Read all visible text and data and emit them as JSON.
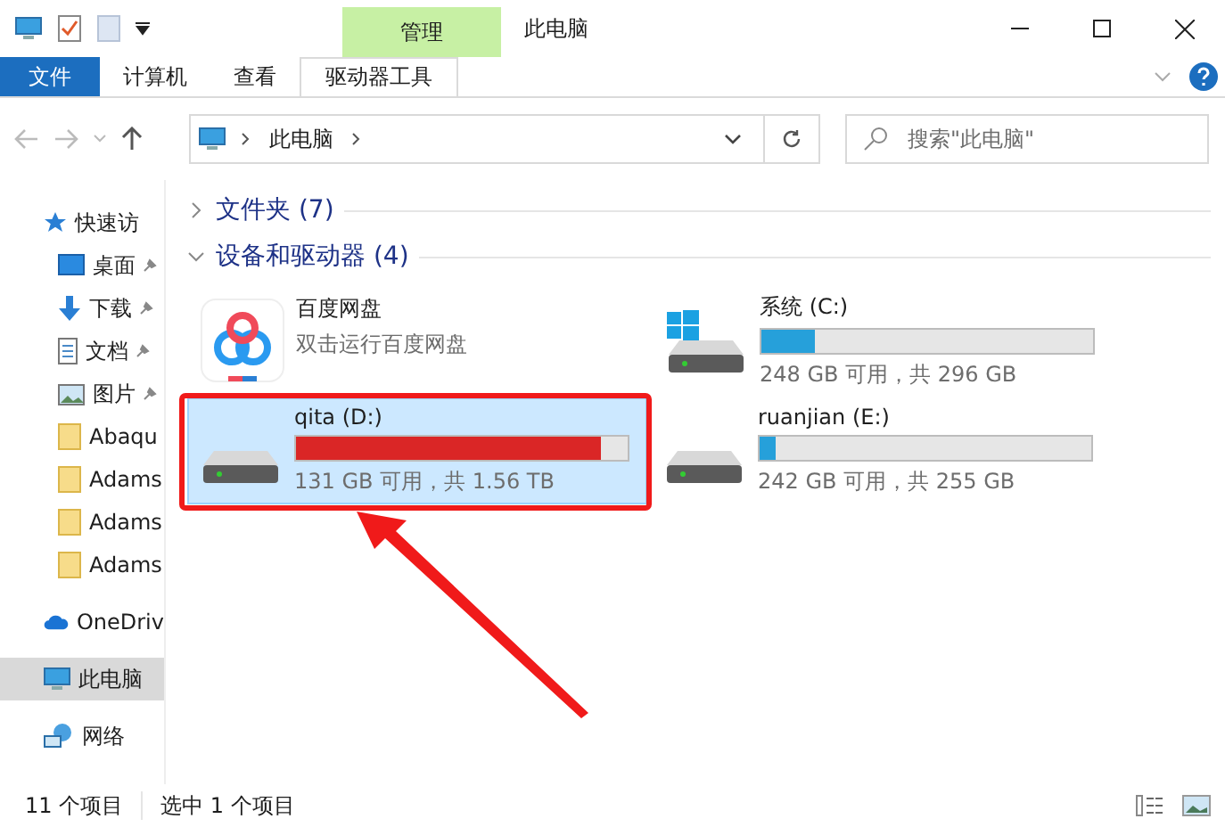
{
  "window": {
    "title": "此电脑",
    "context_tab": "管理"
  },
  "ribbon": {
    "tabs": [
      {
        "label": "文件",
        "kind": "file",
        "selected": false
      },
      {
        "label": "计算机",
        "kind": "tab",
        "selected": false
      },
      {
        "label": "查看",
        "kind": "tab",
        "selected": false
      },
      {
        "label": "驱动器工具",
        "kind": "tab",
        "selected": true
      }
    ]
  },
  "address": {
    "path": [
      "此电脑"
    ]
  },
  "search": {
    "placeholder": "搜索\"此电脑\""
  },
  "sidebar": {
    "items": [
      {
        "label": "快速访",
        "kind": "quick",
        "selected": false,
        "children": [
          {
            "label": "桌面",
            "kind": "desktop",
            "pinned": true,
            "selected": false
          },
          {
            "label": "下载",
            "kind": "download",
            "pinned": true,
            "selected": false
          },
          {
            "label": "文档",
            "kind": "document",
            "pinned": true,
            "selected": false
          },
          {
            "label": "图片",
            "kind": "pictures",
            "pinned": true,
            "selected": false
          },
          {
            "label": "Abaqu",
            "kind": "folder",
            "pinned": false,
            "selected": false
          },
          {
            "label": "Adams",
            "kind": "folder",
            "pinned": false,
            "selected": false
          },
          {
            "label": "Adams",
            "kind": "folder",
            "pinned": false,
            "selected": false
          },
          {
            "label": "Adams",
            "kind": "folder",
            "pinned": false,
            "selected": false
          }
        ]
      },
      {
        "label": "OneDriv",
        "kind": "cloud",
        "selected": false
      },
      {
        "label": "此电脑",
        "kind": "computer",
        "selected": true
      },
      {
        "label": "网络",
        "kind": "network",
        "selected": false
      }
    ]
  },
  "sections": [
    {
      "title": "文件夹 (7)",
      "expanded": false
    },
    {
      "title": "设备和驱动器 (4)",
      "expanded": true,
      "items": [
        {
          "kind": "app",
          "name": "百度网盘",
          "subtitle": "双击运行百度网盘",
          "selected": false
        },
        {
          "kind": "drive",
          "name": "系统 (C:)",
          "system": true,
          "level": 0.16,
          "usage": "248 GB 可用，共 296 GB",
          "selected": false
        },
        {
          "kind": "drive",
          "name": "qita (D:)",
          "system": false,
          "level": 0.92,
          "usage": "131 GB 可用，共 1.56 TB",
          "selected": true
        },
        {
          "kind": "drive",
          "name": "ruanjian (E:)",
          "system": false,
          "level": 0.05,
          "usage": "242 GB 可用，共 255 GB",
          "selected": false
        }
      ]
    }
  ],
  "status_bar": {
    "count": "11 个项目",
    "selection": "选中 1 个项目"
  }
}
